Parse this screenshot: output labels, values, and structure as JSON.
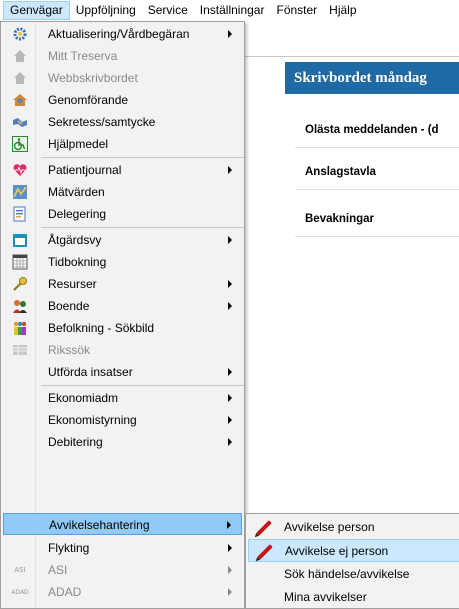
{
  "menubar": {
    "items": [
      "Genvägar",
      "Uppföljning",
      "Service",
      "Inställningar",
      "Fönster",
      "Hjälp"
    ]
  },
  "background": {
    "banner_title": "Skrivbordet måndag",
    "sections": [
      "Olästa meddelanden - (d",
      "Anslagstavla",
      "Bevakningar"
    ]
  },
  "menu": {
    "items": [
      {
        "label": "Aktualisering/Vårdbegäran",
        "icon": "gear-icon",
        "submenu": true,
        "disabled": false
      },
      {
        "label": "Mitt Treserva",
        "icon": "home-icon",
        "submenu": false,
        "disabled": true
      },
      {
        "label": "Webbskrivbordet",
        "icon": "home-icon",
        "submenu": false,
        "disabled": true
      },
      {
        "label": "Genomförande",
        "icon": "house-person-icon",
        "submenu": false,
        "disabled": false
      },
      {
        "label": "Sekretess/samtycke",
        "icon": "handshake-icon",
        "submenu": false,
        "disabled": false
      },
      {
        "label": "Hjälpmedel",
        "icon": "wheelchair-icon",
        "submenu": false,
        "disabled": false
      },
      {
        "label": "Patientjournal",
        "icon": "heart-icon",
        "submenu": true,
        "disabled": false
      },
      {
        "label": "Mätvärden",
        "icon": "measure-icon",
        "submenu": false,
        "disabled": false
      },
      {
        "label": "Delegering",
        "icon": "document-icon",
        "submenu": false,
        "disabled": false
      },
      {
        "label": "Åtgärdsvy",
        "icon": "calendar-icon",
        "submenu": true,
        "disabled": false
      },
      {
        "label": "Tidbokning",
        "icon": "grid-calendar-icon",
        "submenu": false,
        "disabled": false
      },
      {
        "label": "Resurser",
        "icon": "key-icon",
        "submenu": true,
        "disabled": false
      },
      {
        "label": "Boende",
        "icon": "people-icon",
        "submenu": true,
        "disabled": false
      },
      {
        "label": "Befolkning - Sökbild",
        "icon": "population-icon",
        "submenu": false,
        "disabled": false
      },
      {
        "label": "Rikssök",
        "icon": "table-icon",
        "submenu": false,
        "disabled": true
      },
      {
        "label": "Utförda insatser",
        "icon": "",
        "submenu": true,
        "disabled": false
      },
      {
        "label": "Ekonomiadm",
        "icon": "",
        "submenu": true,
        "disabled": false
      },
      {
        "label": "Ekonomistyrning",
        "icon": "",
        "submenu": true,
        "disabled": false
      },
      {
        "label": "Debitering",
        "icon": "",
        "submenu": true,
        "disabled": false
      },
      {
        "label": "Avvikelsehantering",
        "icon": "",
        "submenu": true,
        "disabled": false
      },
      {
        "label": "Flykting",
        "icon": "",
        "submenu": true,
        "disabled": false
      },
      {
        "label": "ASI",
        "icon": "asi-icon",
        "submenu": true,
        "disabled": true
      },
      {
        "label": "ADAD",
        "icon": "adad-icon",
        "submenu": true,
        "disabled": true
      }
    ],
    "icon_text": {
      "asi": "ASI",
      "adad": "ADAD"
    }
  },
  "submenu": {
    "items": [
      {
        "label": "Avvikelse person",
        "icon": "pen-icon"
      },
      {
        "label": "Avvikelse ej person",
        "icon": "pen-icon"
      },
      {
        "label": "Sök händelse/avvikelse",
        "icon": ""
      },
      {
        "label": "Mina avvikelser",
        "icon": ""
      }
    ]
  },
  "colors": {
    "banner": "#1f6aa5",
    "highlight": "#91c9f7",
    "hover": "#cce8ff"
  }
}
